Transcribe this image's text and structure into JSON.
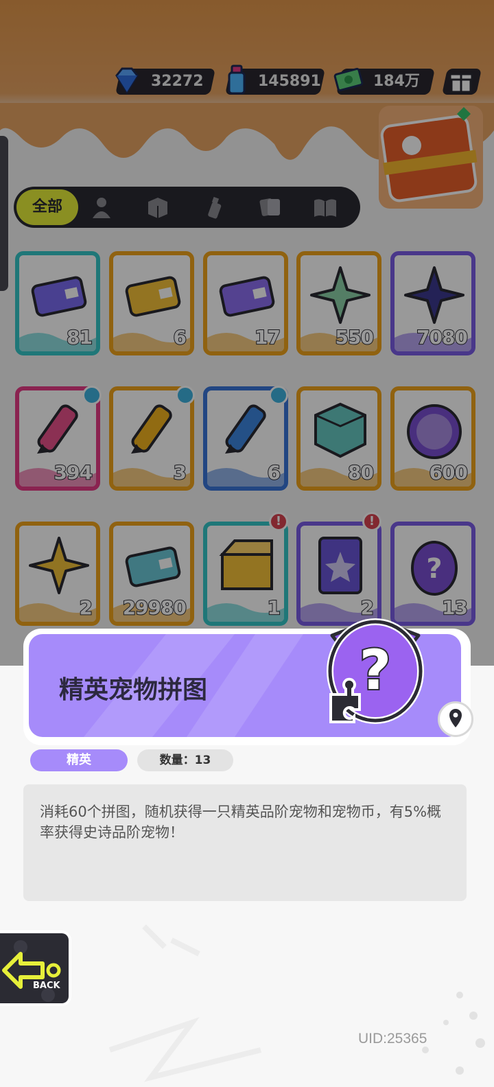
{
  "currencies": [
    {
      "name": "diamond-icon",
      "value": "32272"
    },
    {
      "name": "spray-can-icon",
      "value": "145891"
    },
    {
      "name": "cash-icon",
      "value": "184万"
    }
  ],
  "tabs": [
    {
      "label": "全部",
      "icon": "all"
    },
    {
      "icon": "person-icon"
    },
    {
      "icon": "box-icon"
    },
    {
      "icon": "spray-icon"
    },
    {
      "icon": "cards-icon"
    },
    {
      "icon": "book-icon"
    }
  ],
  "items": [
    {
      "icon": "crown-ticket-icon",
      "qty": "81",
      "color": "#35c7c9"
    },
    {
      "icon": "yellow-ticket-icon",
      "qty": "6",
      "color": "#f0a31c"
    },
    {
      "icon": "purple-ticket-icon",
      "qty": "17",
      "color": "#f0a31c"
    },
    {
      "icon": "rainbow-star-icon",
      "qty": "550",
      "color": "#f0a31c"
    },
    {
      "icon": "blue-star-icon",
      "qty": "7080",
      "color": "#7b5ce6"
    },
    {
      "icon": "pink-crayon-icon",
      "qty": "394",
      "color": "#e63b86"
    },
    {
      "icon": "yellow-crayon-icon",
      "qty": "3",
      "color": "#f0a31c"
    },
    {
      "icon": "blue-crayon-icon",
      "qty": "6",
      "color": "#3a76d9"
    },
    {
      "icon": "cube-icon",
      "qty": "80",
      "color": "#f0a31c"
    },
    {
      "icon": "cool-badge-icon",
      "qty": "600",
      "color": "#f0a31c"
    },
    {
      "icon": "star-burst-icon",
      "qty": "2",
      "color": "#f0a31c"
    },
    {
      "icon": "planet-ticket-icon",
      "qty": "29980",
      "color": "#f0a31c"
    },
    {
      "icon": "cool-box-icon",
      "qty": "1",
      "color": "#35c7c9"
    },
    {
      "icon": "star-card-icon",
      "qty": "2",
      "color": "#7b5ce6"
    },
    {
      "icon": "mystery-egg-icon",
      "qty": "13",
      "color": "#7b5ce6"
    }
  ],
  "detail": {
    "title": "精英宠物拼图",
    "rarity": "精英",
    "count_label": "数量：13",
    "description": "消耗60个拼图，随机获得一只精英品阶宠物和宠物币，有5%概率获得史诗品阶宠物！"
  },
  "uid": "UID:25365",
  "colors": {
    "accent_purple": "#a68bfa",
    "tab_active": "#e6ef3a",
    "dark": "#2b2b33"
  }
}
